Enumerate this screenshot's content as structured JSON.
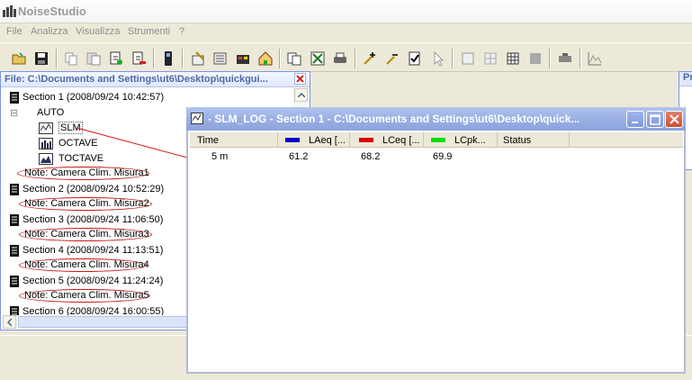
{
  "app": {
    "title": "NoiseStudio"
  },
  "menu": [
    "File",
    "Analizza",
    "Visualizza",
    "Strumenti",
    "?"
  ],
  "toolbar_icons": [
    "open-folder-icon",
    "save-icon",
    "copy-doc-icon",
    "paste-doc-icon",
    "add-doc-icon",
    "remove-doc-icon",
    "device-icon",
    "settings-icon",
    "config-icon",
    "tool-icon",
    "home-icon",
    "duplicate-icon",
    "export-excel-icon",
    "print-icon",
    "marker-plus-icon",
    "marker-minus-icon",
    "check-doc-icon",
    "pointer-icon",
    "frame-icon",
    "grid-icon",
    "table-icon",
    "stop-icon",
    "gear-icon",
    "chart-icon"
  ],
  "file_window": {
    "title": "File: C:\\Documents and Settings\\ut6\\Desktop\\quickgui...",
    "tree": [
      {
        "kind": "section",
        "label": "Section 1   (2008/09/24 10:42:57)"
      },
      {
        "kind": "group",
        "label": "AUTO"
      },
      {
        "kind": "item",
        "label": "SLM"
      },
      {
        "kind": "item",
        "label": "OCTAVE"
      },
      {
        "kind": "item",
        "label": "TOCTAVE"
      },
      {
        "kind": "note",
        "label": "Note: Camera Clim. Misura1"
      },
      {
        "kind": "section",
        "label": "Section 2   (2008/09/24 10:52:29)"
      },
      {
        "kind": "note",
        "label": "Note: Camera Clim. Misura2"
      },
      {
        "kind": "section",
        "label": "Section 3   (2008/09/24 11:06:50)"
      },
      {
        "kind": "note",
        "label": "Note: Camera Clim. Misura3"
      },
      {
        "kind": "section",
        "label": "Section 4   (2008/09/24 11:13:51)"
      },
      {
        "kind": "note",
        "label": "Note: Camera Clim. Misura4"
      },
      {
        "kind": "section",
        "label": "Section 5   (2008/09/24 11:24:24)"
      },
      {
        "kind": "note",
        "label": "Note: Camera Clim. Misura5"
      },
      {
        "kind": "section",
        "label": "Section 6   (2008/09/24 16:00:55)"
      }
    ]
  },
  "slm_window": {
    "title": " - SLM_LOG - Section 1 -  C:\\Documents and Settings\\ut6\\Desktop\\quick...",
    "columns": [
      {
        "label": "Time",
        "color": ""
      },
      {
        "label": "LAeq [...",
        "color": "#0000c8"
      },
      {
        "label": "LCeq [...",
        "color": "#dc0000"
      },
      {
        "label": "LCpk...",
        "color": "#00dc00"
      },
      {
        "label": "Status",
        "color": ""
      }
    ],
    "rows": [
      [
        "5 m",
        "61.2",
        "68.2",
        "69.9",
        ""
      ]
    ]
  },
  "right_fragment": {
    "label": "Pr"
  }
}
